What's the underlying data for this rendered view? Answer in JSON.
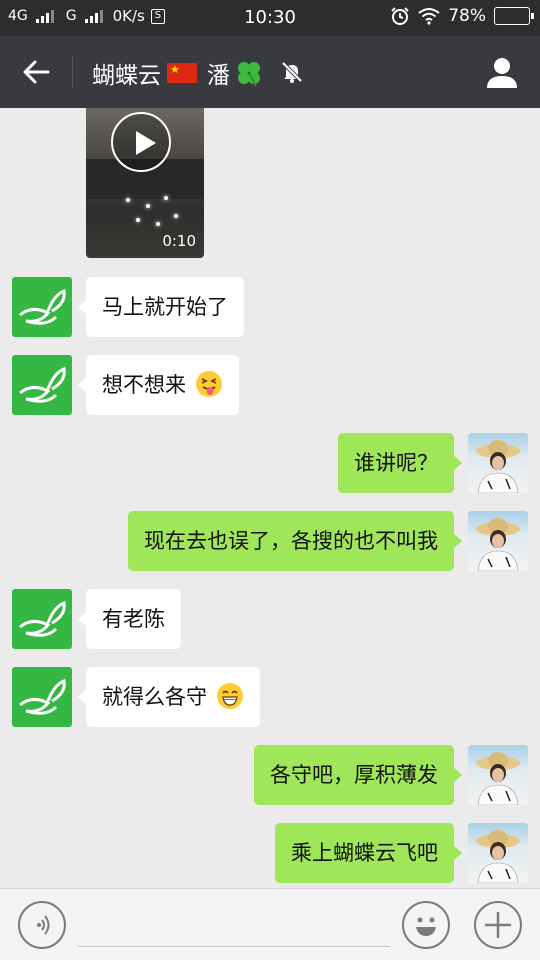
{
  "status_bar": {
    "network_1": "4G",
    "network_2": "G",
    "speed": "0K/s",
    "s_badge": "S",
    "time": "10:30",
    "battery": "78%",
    "battery_level": 0.78,
    "battery_color": "#4cd43a"
  },
  "header": {
    "title": "蝴蝶云",
    "title_suffix": "潘",
    "flag_icon": "china-flag-icon",
    "clover_icon": "four-leaf-clover-icon",
    "muted_icon": "bell-muted-icon"
  },
  "video": {
    "duration": "0:10"
  },
  "messages": [
    {
      "side": "in",
      "text": "马上就开始了"
    },
    {
      "side": "in",
      "text": "想不想来",
      "emoji": "tongue-out-emoji"
    },
    {
      "side": "out",
      "text": "谁讲呢？"
    },
    {
      "side": "out",
      "text": "现在去也误了，各搜的也不叫我"
    },
    {
      "side": "in",
      "text": "有老陈"
    },
    {
      "side": "in",
      "text": "就得么各守",
      "emoji": "grin-emoji"
    },
    {
      "side": "out",
      "text": "各守吧，厚积薄发"
    },
    {
      "side": "out",
      "text": "乘上蝴蝶云飞吧"
    }
  ],
  "colors": {
    "header_bg": "#393a3f",
    "status_bg": "#2d2d2d",
    "chat_bg": "#ebebeb",
    "out_bubble": "#9fe658",
    "in_bubble": "#ffffff",
    "avatar_green": "#35b843"
  }
}
